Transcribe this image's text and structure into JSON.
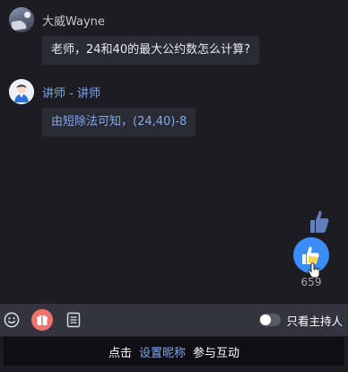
{
  "messages": [
    {
      "sender": "大威Wayne",
      "text": "老师，24和40的最大公约数怎么计算?"
    },
    {
      "sender": "讲师 - 讲师",
      "text": "由短除法可知，(24,40)-8"
    }
  ],
  "like": {
    "count": "659",
    "icon": "thumbs-up-icon"
  },
  "toolbar": {
    "icons": [
      "emoji-icon",
      "gift-icon",
      "notes-icon"
    ],
    "host_only_label": "只看主持人",
    "host_only_enabled": false
  },
  "cta": {
    "prefix": "点击",
    "link": "设置昵称",
    "suffix": "参与互动"
  },
  "colors": {
    "accent": "#3c8cf5",
    "link": "#7fa8ec",
    "gift": "#f0736b",
    "background": "#1c1c22"
  }
}
